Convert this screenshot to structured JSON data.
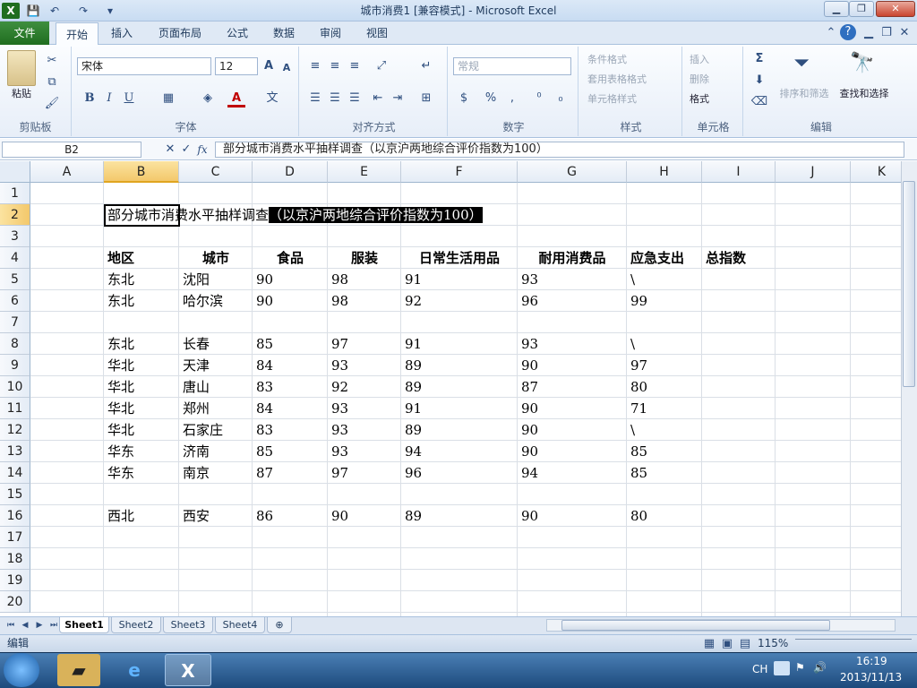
{
  "window": {
    "title": "城市消费1 [兼容模式] - Microsoft Excel",
    "minimize": "▁",
    "restore": "❐",
    "close": "✕"
  },
  "quick_access": {
    "save_icon": "💾",
    "undo_icon": "↶",
    "redo_icon": "↷",
    "customize_icon": "▾"
  },
  "ribbon_tabs": [
    "开始",
    "插入",
    "页面布局",
    "公式",
    "数据",
    "审阅",
    "视图"
  ],
  "file_tab": "文件",
  "ribbon": {
    "clipboard": {
      "paste": "粘贴",
      "label": "剪贴板"
    },
    "font": {
      "name": "宋体",
      "size": "12",
      "bold": "B",
      "italic": "I",
      "underline": "U",
      "label": "字体"
    },
    "align": {
      "label": "对齐方式"
    },
    "number": {
      "format": "常规",
      "label": "数字",
      "percent": "%",
      "comma": ","
    },
    "styles": {
      "cond": "条件格式",
      "table": "套用表格格式",
      "cell": "单元格样式",
      "label": "样式"
    },
    "cells": {
      "insert": "插入",
      "delete": "删除",
      "format": "格式",
      "label": "单元格"
    },
    "edit": {
      "sum": "Σ",
      "sort": "排序和筛选",
      "find": "查找和选择",
      "label": "编辑"
    }
  },
  "formula_bar": {
    "name_box": "B2",
    "content": "部分城市消费水平抽样调查（以京沪两地综合评价指数为100）",
    "fx": "fx"
  },
  "columns": [
    "A",
    "B",
    "C",
    "D",
    "E",
    "F",
    "G",
    "H",
    "I",
    "J",
    "K"
  ],
  "rows": [
    "1",
    "2",
    "3",
    "4",
    "5",
    "6",
    "7",
    "8",
    "9",
    "10",
    "11",
    "12",
    "13",
    "14",
    "15",
    "16",
    "17",
    "18",
    "19",
    "20"
  ],
  "sheet": {
    "title_part1": "部分城市消费水平抽样调查",
    "title_part2": "（以京沪两地综合评价指数为100）",
    "headers": [
      "地区",
      "城市",
      "食品",
      "服装",
      "日常生活用品",
      "耐用消费品",
      "应急支出",
      "总指数"
    ],
    "data": [
      {
        "row": 5,
        "cells": [
          "东北",
          "沈阳",
          "90",
          "98",
          "91",
          "93",
          "\\"
        ]
      },
      {
        "row": 6,
        "cells": [
          "东北",
          "哈尔滨",
          "90",
          "98",
          "92",
          "96",
          "99"
        ]
      },
      {
        "row": 8,
        "cells": [
          "东北",
          "长春",
          "85",
          "97",
          "91",
          "93",
          "\\"
        ]
      },
      {
        "row": 9,
        "cells": [
          "华北",
          "天津",
          "84",
          "93",
          "89",
          "90",
          "97"
        ]
      },
      {
        "row": 10,
        "cells": [
          "华北",
          "唐山",
          "83",
          "92",
          "89",
          "87",
          "80"
        ]
      },
      {
        "row": 11,
        "cells": [
          "华北",
          "郑州",
          "84",
          "93",
          "91",
          "90",
          "71"
        ]
      },
      {
        "row": 12,
        "cells": [
          "华北",
          "石家庄",
          "83",
          "93",
          "89",
          "90",
          "\\"
        ]
      },
      {
        "row": 13,
        "cells": [
          "华东",
          "济南",
          "85",
          "93",
          "94",
          "90",
          "85"
        ]
      },
      {
        "row": 14,
        "cells": [
          "华东",
          "南京",
          "87",
          "97",
          "96",
          "94",
          "85"
        ]
      },
      {
        "row": 16,
        "cells": [
          "西北",
          "西安",
          "86",
          "90",
          "89",
          "90",
          "80"
        ]
      }
    ]
  },
  "sheet_tabs": [
    "Sheet1",
    "Sheet2",
    "Sheet3",
    "Sheet4"
  ],
  "status": {
    "mode": "编辑",
    "zoom": "115%"
  },
  "taskbar": {
    "lang": "CH",
    "time": "16:19",
    "date": "2013/11/13"
  }
}
